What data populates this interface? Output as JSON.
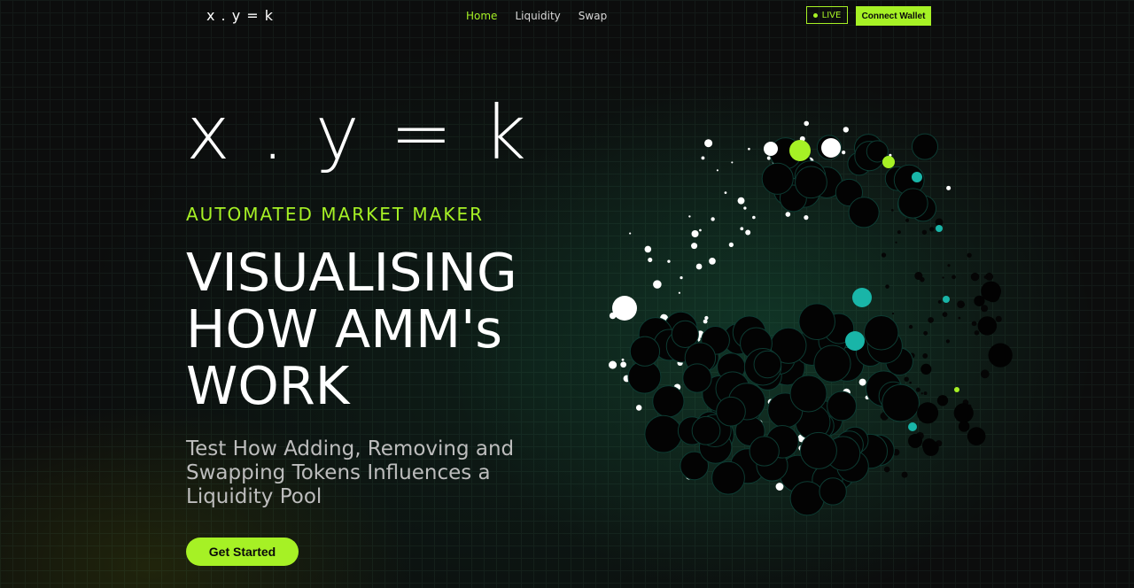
{
  "nav": {
    "logo": "x . y = k",
    "links": [
      {
        "label": "Home",
        "active": true
      },
      {
        "label": "Liquidity",
        "active": false
      },
      {
        "label": "Swap",
        "active": false
      }
    ],
    "live_label": "LIVE",
    "connect_label": "Connect Wallet"
  },
  "hero": {
    "formula": "x . y = k",
    "subtitle": "AUTOMATED MARKET MAKER",
    "headline": [
      "VISUALISING",
      "HOW AMM's",
      "WORK"
    ],
    "description": "Test How Adding, Removing and Swapping Tokens Influences a Liquidity Pool",
    "cta_label": "Get Started"
  },
  "colors": {
    "accent": "#a6f125",
    "teal": "#19b5a8",
    "background": "#0c0d0d"
  },
  "icons": {
    "live_indicator": "live-dot-icon"
  }
}
